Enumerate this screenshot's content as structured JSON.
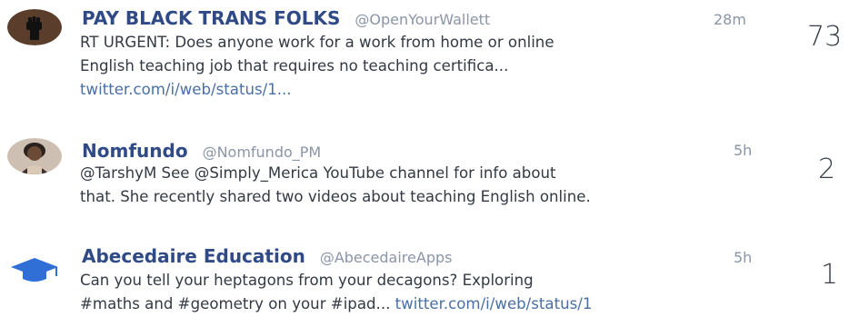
{
  "tweets": [
    {
      "avatar_icon": "raised-fist-icon",
      "avatar_color": "#5a3d2b",
      "name": "PAY BLACK TRANS FOLKS",
      "handle": "@OpenYourWallett",
      "time": "28m",
      "lines": [
        "RT URGENT: Does anyone work for a work from home or online",
        "English teaching job that requires no teaching certifica..."
      ],
      "link": "twitter.com/i/web/status/1...",
      "count": "73"
    },
    {
      "avatar_icon": "person-photo-icon",
      "avatar_color": "#c9b8a8",
      "name": "Nomfundo",
      "handle": "@Nomfundo_PM",
      "time": "5h",
      "lines": [
        "@TarshyM See @Simply_Merica YouTube channel for info about",
        "that. She recently shared two videos about teaching English online."
      ],
      "count": "2"
    },
    {
      "avatar_icon": "graduation-cap-icon",
      "avatar_color": "#2f6fd6",
      "name": "Abecedaire Education",
      "handle": "@AbecedaireApps",
      "time": "5h",
      "lines": [
        "Can you tell your heptagons from your decagons? Exploring"
      ],
      "line2_text": "#maths and #geometry on your #ipad... ",
      "line2_link": "twitter.com/i/web/status/1",
      "count": "1"
    }
  ]
}
